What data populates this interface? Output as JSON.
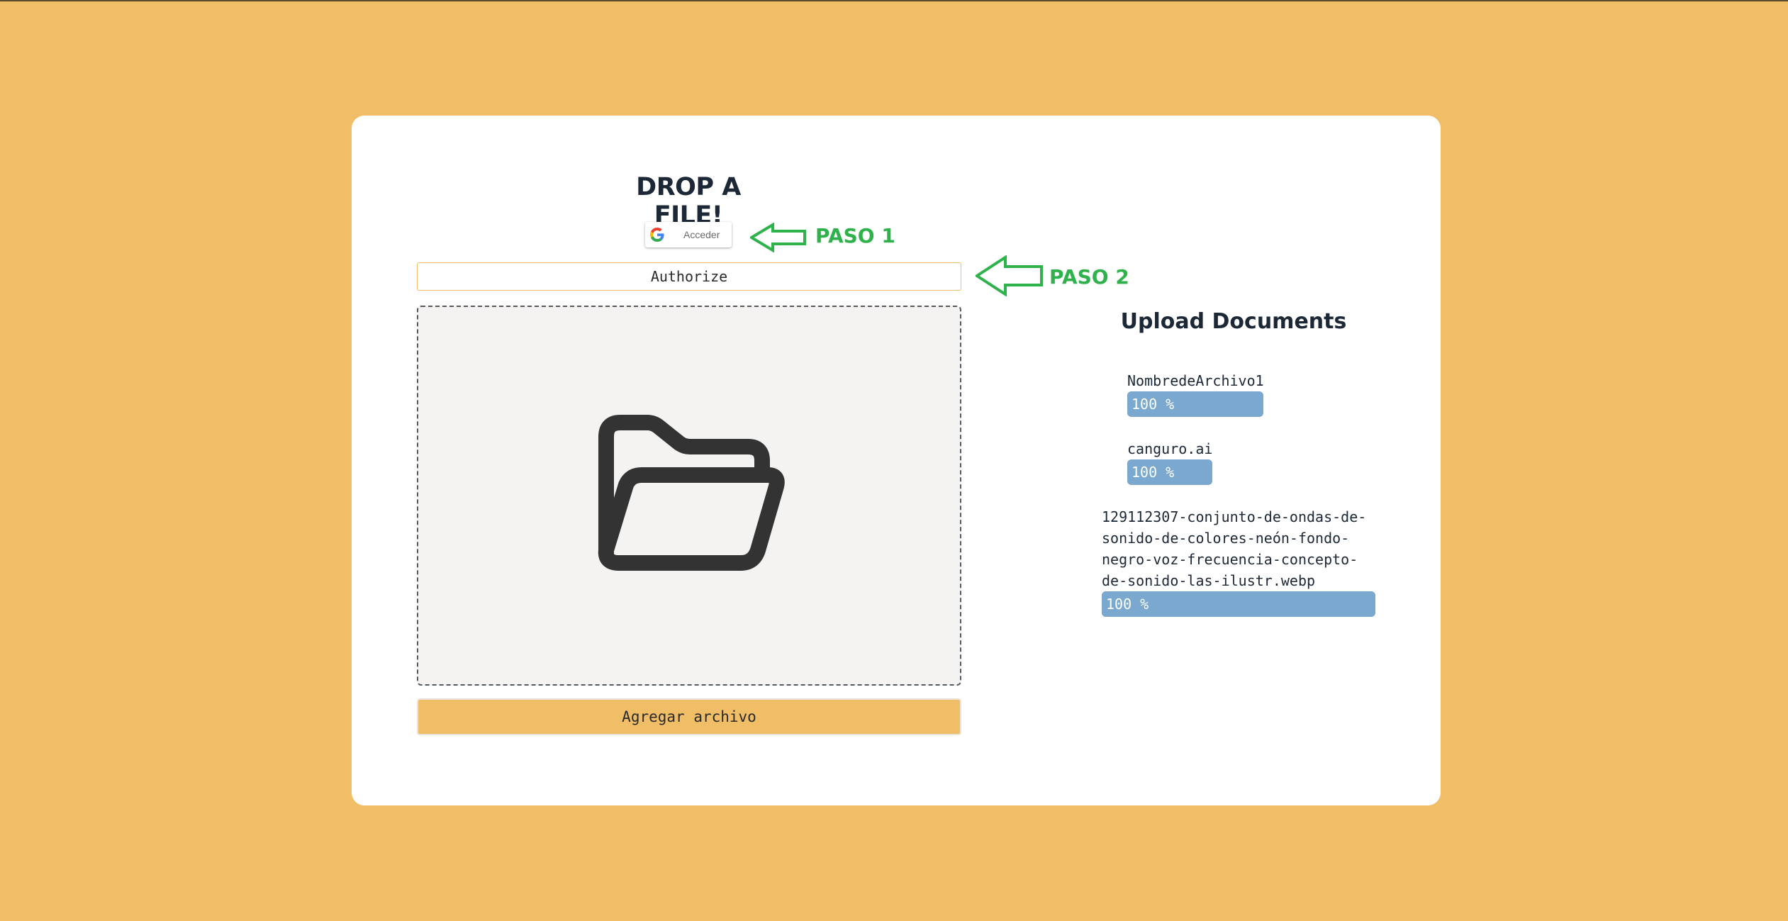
{
  "page": {
    "title": "DROP A FILE!",
    "background_color": "#f1be68"
  },
  "google_button": {
    "label": "Acceder",
    "icon": "google-g-icon"
  },
  "annotations": {
    "step1": "PASO 1",
    "step2": "PASO 2",
    "arrow_color": "#2fb24c"
  },
  "authorize_button": {
    "label": "Authorize"
  },
  "dropzone": {
    "icon": "folder-open-icon"
  },
  "add_button": {
    "label": "Agregar archivo"
  },
  "uploads": {
    "title": "Upload Documents",
    "items": [
      {
        "name": "NombredeArchivo1",
        "progress_text": "100 %",
        "progress": 100
      },
      {
        "name": "canguro.ai",
        "progress_text": "100 %",
        "progress": 100
      },
      {
        "name": "129112307-conjunto-de-ondas-de-\nsonido-de-colores-neón-fondo-\nnegro-voz-frecuencia-concepto-\nde-sonido-las-ilustr.webp",
        "progress_text": "100 %",
        "progress": 100
      }
    ],
    "bar_color": "#7ba8cf"
  }
}
